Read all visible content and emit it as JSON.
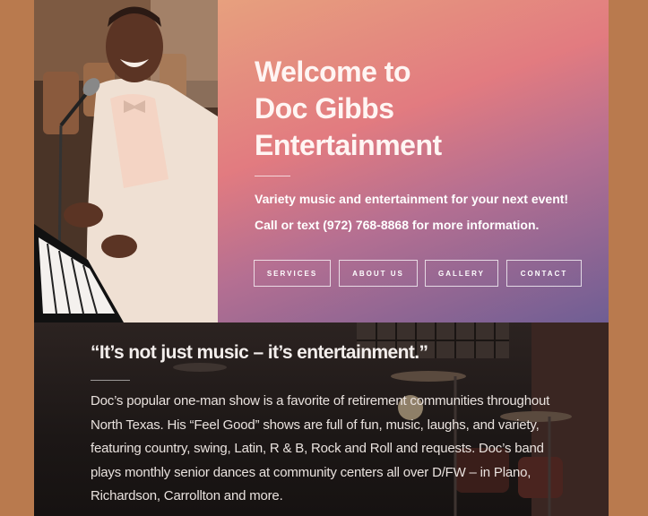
{
  "hero": {
    "title_line1": "Welcome to",
    "title_line2": "Doc Gibbs",
    "title_line3": "Entertainment",
    "subtitle": "Variety music and entertainment for your next event!",
    "contact_line": "Call or text (972) 768-8868 for more information.",
    "buttons": [
      "SERVICES",
      "ABOUT US",
      "GALLERY",
      "CONTACT"
    ]
  },
  "section": {
    "quote": "“It’s not just music – it’s entertainment.”",
    "body": "Doc’s popular one-man show is a favorite of retirement communities throughout North Texas. His “Feel Good” shows are full of fun, music, laughs, and variety, featuring country, swing, Latin, R & B, Rock and Roll and requests. Doc’s band plays monthly senior dances at community centers all over D/FW – in Plano, Richardson, Carrollton and more."
  },
  "colors": {
    "side_background": "#b97a4e",
    "hero_gradient_top": "#e7a07e",
    "hero_gradient_mid": "#e27b80",
    "hero_gradient_bottom": "#6f5e94",
    "dark_section": "#1c1716"
  },
  "icons": {
    "hero_photo": "performer-at-piano-photo",
    "section_background": "stage-drum-kit-photo"
  }
}
